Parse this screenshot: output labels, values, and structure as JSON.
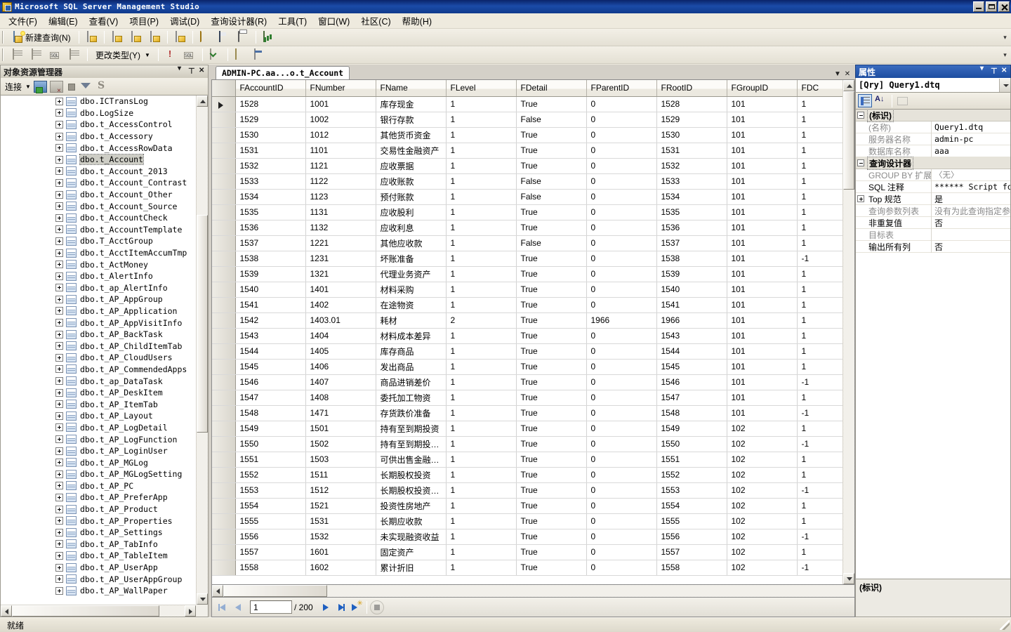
{
  "window": {
    "title": "Microsoft SQL Server Management Studio",
    "app_icon": "ssms-icon",
    "minimize": "minimize-icon",
    "maximize": "maximize-icon",
    "close": "close-icon"
  },
  "menubar": {
    "items": [
      {
        "label": "文件(F)"
      },
      {
        "label": "编辑(E)"
      },
      {
        "label": "查看(V)"
      },
      {
        "label": "项目(P)"
      },
      {
        "label": "调试(D)"
      },
      {
        "label": "查询设计器(R)"
      },
      {
        "label": "工具(T)"
      },
      {
        "label": "窗口(W)"
      },
      {
        "label": "社区(C)"
      },
      {
        "label": "帮助(H)"
      }
    ]
  },
  "toolbar_main": {
    "new_query_label": "新建查询(N)",
    "buttons": [
      {
        "name": "new-database-engine-query-icon"
      },
      {
        "name": "new-analysis-services-mdx-query-icon"
      },
      {
        "name": "new-analysis-services-dmx-query-icon"
      },
      {
        "name": "new-analysis-services-xmla-query-icon"
      },
      {
        "name": "new-sql-server-compact-query-icon"
      },
      {
        "name": "open-file-icon"
      },
      {
        "name": "save-icon"
      },
      {
        "name": "print-icon"
      },
      {
        "name": "activity-monitor-icon"
      }
    ]
  },
  "toolbar_designer": {
    "change_type_label": "更改类型(Y)",
    "buttons": [
      {
        "name": "show-diagram-pane-icon"
      },
      {
        "name": "show-criteria-pane-icon"
      },
      {
        "name": "show-sql-pane-icon"
      },
      {
        "name": "show-results-pane-icon"
      },
      {
        "name": "execute-sql-icon"
      },
      {
        "name": "verify-sql-syntax-icon"
      },
      {
        "name": "group-by-icon"
      },
      {
        "name": "add-table-icon"
      },
      {
        "name": "add-new-derived-table-icon"
      }
    ]
  },
  "object_explorer": {
    "title": "对象资源管理器",
    "connect_label": "连接",
    "toolbar_icons": [
      "connect-icon",
      "disconnect-icon",
      "stop-icon",
      "filter-icon",
      "refresh-icon"
    ],
    "nodes": [
      {
        "label": "dbo.ICTransLog",
        "selected": false
      },
      {
        "label": "dbo.LogSize",
        "selected": false
      },
      {
        "label": "dbo.t_AccessControl",
        "selected": false
      },
      {
        "label": "dbo.t_Accessory",
        "selected": false
      },
      {
        "label": "dbo.t_AccessRowData",
        "selected": false
      },
      {
        "label": "dbo.t_Account",
        "selected": true
      },
      {
        "label": "dbo.t_Account_2013",
        "selected": false
      },
      {
        "label": "dbo.t_Account_Contrast",
        "selected": false
      },
      {
        "label": "dbo.t_Account_Other",
        "selected": false
      },
      {
        "label": "dbo.t_Account_Source",
        "selected": false
      },
      {
        "label": "dbo.t_AccountCheck",
        "selected": false
      },
      {
        "label": "dbo.t_AccountTemplate",
        "selected": false
      },
      {
        "label": "dbo.T_AcctGroup",
        "selected": false
      },
      {
        "label": "dbo.t_AcctItemAccumTmp",
        "selected": false
      },
      {
        "label": "dbo.t_ActMoney",
        "selected": false
      },
      {
        "label": "dbo.t_AlertInfo",
        "selected": false
      },
      {
        "label": "dbo.t_ap_AlertInfo",
        "selected": false
      },
      {
        "label": "dbo.t_AP_AppGroup",
        "selected": false
      },
      {
        "label": "dbo.t_AP_Application",
        "selected": false
      },
      {
        "label": "dbo.t_AP_AppVisitInfo",
        "selected": false
      },
      {
        "label": "dbo.t_AP_BackTask",
        "selected": false
      },
      {
        "label": "dbo.t_AP_ChildItemTab",
        "selected": false
      },
      {
        "label": "dbo.t_AP_CloudUsers",
        "selected": false
      },
      {
        "label": "dbo.t_AP_CommendedApps",
        "selected": false
      },
      {
        "label": "dbo.t_ap_DataTask",
        "selected": false
      },
      {
        "label": "dbo.t_AP_DeskItem",
        "selected": false
      },
      {
        "label": "dbo.t_AP_ItemTab",
        "selected": false
      },
      {
        "label": "dbo.t_AP_Layout",
        "selected": false
      },
      {
        "label": "dbo.t_AP_LogDetail",
        "selected": false
      },
      {
        "label": "dbo.t_AP_LogFunction",
        "selected": false
      },
      {
        "label": "dbo.t_AP_LoginUser",
        "selected": false
      },
      {
        "label": "dbo.t_AP_MGLog",
        "selected": false
      },
      {
        "label": "dbo.t_AP_MGLogSetting",
        "selected": false
      },
      {
        "label": "dbo.t_AP_PC",
        "selected": false
      },
      {
        "label": "dbo.t_AP_PreferApp",
        "selected": false
      },
      {
        "label": "dbo.t_AP_Product",
        "selected": false
      },
      {
        "label": "dbo.t_AP_Properties",
        "selected": false
      },
      {
        "label": "dbo.t_AP_Settings",
        "selected": false
      },
      {
        "label": "dbo.t_AP_TabInfo",
        "selected": false
      },
      {
        "label": "dbo.t_AP_TableItem",
        "selected": false
      },
      {
        "label": "dbo.t_AP_UserApp",
        "selected": false
      },
      {
        "label": "dbo.t_AP_UserAppGroup",
        "selected": false
      },
      {
        "label": "dbo.t_AP_WallPaper",
        "selected": false
      }
    ]
  },
  "document": {
    "tab_label": "ADMIN-PC.aa...o.t_Account",
    "columns": [
      "FAccountID",
      "FNumber",
      "FName",
      "FLevel",
      "FDetail",
      "FParentID",
      "FRootID",
      "FGroupID",
      "FDC"
    ],
    "rows": [
      [
        "1528",
        "1001",
        "库存现金",
        "1",
        "True",
        "0",
        "1528",
        "101",
        "1"
      ],
      [
        "1529",
        "1002",
        "银行存款",
        "1",
        "False",
        "0",
        "1529",
        "101",
        "1"
      ],
      [
        "1530",
        "1012",
        "其他货币资金",
        "1",
        "True",
        "0",
        "1530",
        "101",
        "1"
      ],
      [
        "1531",
        "1101",
        "交易性金融资产",
        "1",
        "True",
        "0",
        "1531",
        "101",
        "1"
      ],
      [
        "1532",
        "1121",
        "应收票据",
        "1",
        "True",
        "0",
        "1532",
        "101",
        "1"
      ],
      [
        "1533",
        "1122",
        "应收账款",
        "1",
        "False",
        "0",
        "1533",
        "101",
        "1"
      ],
      [
        "1534",
        "1123",
        "预付账款",
        "1",
        "False",
        "0",
        "1534",
        "101",
        "1"
      ],
      [
        "1535",
        "1131",
        "应收股利",
        "1",
        "True",
        "0",
        "1535",
        "101",
        "1"
      ],
      [
        "1536",
        "1132",
        "应收利息",
        "1",
        "True",
        "0",
        "1536",
        "101",
        "1"
      ],
      [
        "1537",
        "1221",
        "其他应收款",
        "1",
        "False",
        "0",
        "1537",
        "101",
        "1"
      ],
      [
        "1538",
        "1231",
        "坏账准备",
        "1",
        "True",
        "0",
        "1538",
        "101",
        "-1"
      ],
      [
        "1539",
        "1321",
        "代理业务资产",
        "1",
        "True",
        "0",
        "1539",
        "101",
        "1"
      ],
      [
        "1540",
        "1401",
        "材料采购",
        "1",
        "True",
        "0",
        "1540",
        "101",
        "1"
      ],
      [
        "1541",
        "1402",
        "在途物资",
        "1",
        "True",
        "0",
        "1541",
        "101",
        "1"
      ],
      [
        "1542",
        "1403.01",
        "耗材",
        "2",
        "True",
        "1966",
        "1966",
        "101",
        "1"
      ],
      [
        "1543",
        "1404",
        "材料成本差异",
        "1",
        "True",
        "0",
        "1543",
        "101",
        "1"
      ],
      [
        "1544",
        "1405",
        "库存商品",
        "1",
        "True",
        "0",
        "1544",
        "101",
        "1"
      ],
      [
        "1545",
        "1406",
        "发出商品",
        "1",
        "True",
        "0",
        "1545",
        "101",
        "1"
      ],
      [
        "1546",
        "1407",
        "商品进销差价",
        "1",
        "True",
        "0",
        "1546",
        "101",
        "-1"
      ],
      [
        "1547",
        "1408",
        "委托加工物资",
        "1",
        "True",
        "0",
        "1547",
        "101",
        "1"
      ],
      [
        "1548",
        "1471",
        "存货跌价准备",
        "1",
        "True",
        "0",
        "1548",
        "101",
        "-1"
      ],
      [
        "1549",
        "1501",
        "持有至到期投资",
        "1",
        "True",
        "0",
        "1549",
        "102",
        "1"
      ],
      [
        "1550",
        "1502",
        "持有至到期投…",
        "1",
        "True",
        "0",
        "1550",
        "102",
        "-1"
      ],
      [
        "1551",
        "1503",
        "可供出售金融…",
        "1",
        "True",
        "0",
        "1551",
        "102",
        "1"
      ],
      [
        "1552",
        "1511",
        "长期股权投资",
        "1",
        "True",
        "0",
        "1552",
        "102",
        "1"
      ],
      [
        "1553",
        "1512",
        "长期股权投资…",
        "1",
        "True",
        "0",
        "1553",
        "102",
        "-1"
      ],
      [
        "1554",
        "1521",
        "投资性房地产",
        "1",
        "True",
        "0",
        "1554",
        "102",
        "1"
      ],
      [
        "1555",
        "1531",
        "长期应收款",
        "1",
        "True",
        "0",
        "1555",
        "102",
        "1"
      ],
      [
        "1556",
        "1532",
        "未实现融资收益",
        "1",
        "True",
        "0",
        "1556",
        "102",
        "-1"
      ],
      [
        "1557",
        "1601",
        "固定资产",
        "1",
        "True",
        "0",
        "1557",
        "102",
        "1"
      ],
      [
        "1558",
        "1602",
        "累计折旧",
        "1",
        "True",
        "0",
        "1558",
        "102",
        "-1"
      ]
    ],
    "current_row_index": 0,
    "navigation": {
      "first_label": "first-record",
      "prev_label": "previous-record",
      "current_page": "1",
      "total_label": "/ 200",
      "next_label": "next-record",
      "last_label": "last-record",
      "new_label": "new-record",
      "stop_label": "stop"
    }
  },
  "properties": {
    "title": "属性",
    "selected_object": "[Qry] Query1.dtq",
    "toolbar_icons": [
      "categorized-icon",
      "alphabetical-icon",
      "property-pages-icon"
    ],
    "groups": [
      {
        "name": "(标识)",
        "expander": "minus",
        "rows": [
          {
            "name": "(名称)",
            "value": "Query1.dtq",
            "dim_name": true,
            "dim_value": false,
            "expander": "none"
          },
          {
            "name": "服务器名称",
            "value": "admin-pc",
            "dim_name": true,
            "dim_value": false,
            "expander": "none"
          },
          {
            "name": "数据库名称",
            "value": "aaa",
            "dim_name": true,
            "dim_value": false,
            "expander": "none"
          }
        ]
      },
      {
        "name": "查询设计器",
        "expander": "minus",
        "rows": [
          {
            "name": "GROUP BY 扩展",
            "value": "〈无〉",
            "dim_name": true,
            "dim_value": true,
            "expander": "none"
          },
          {
            "name": "SQL 注释",
            "value": "****** Script for S",
            "dim_name": false,
            "dim_value": false,
            "expander": "none"
          },
          {
            "name": "Top 规范",
            "value": "是",
            "dim_name": false,
            "dim_value": false,
            "expander": "plus",
            "cn_value": true
          },
          {
            "name": "查询参数列表",
            "value": "没有为此查询指定参",
            "dim_name": true,
            "dim_value": true,
            "expander": "none",
            "cn_value": true
          },
          {
            "name": "非重复值",
            "value": "否",
            "dim_name": false,
            "dim_value": false,
            "expander": "none",
            "cn_value": true
          },
          {
            "name": "目标表",
            "value": "",
            "dim_name": true,
            "dim_value": true,
            "expander": "none"
          },
          {
            "name": "输出所有列",
            "value": "否",
            "dim_name": false,
            "dim_value": false,
            "expander": "none",
            "cn_value": true
          }
        ]
      }
    ],
    "description_title": "(标识)"
  },
  "statusbar": {
    "text": "就绪"
  },
  "colors": {
    "title_bar": "#0a246a",
    "accent_blue": "#1e5fc0",
    "toolbar_bg": "#eeeade",
    "panel_bg": "#d4d0c8",
    "grid_bg": "#ffffff"
  }
}
